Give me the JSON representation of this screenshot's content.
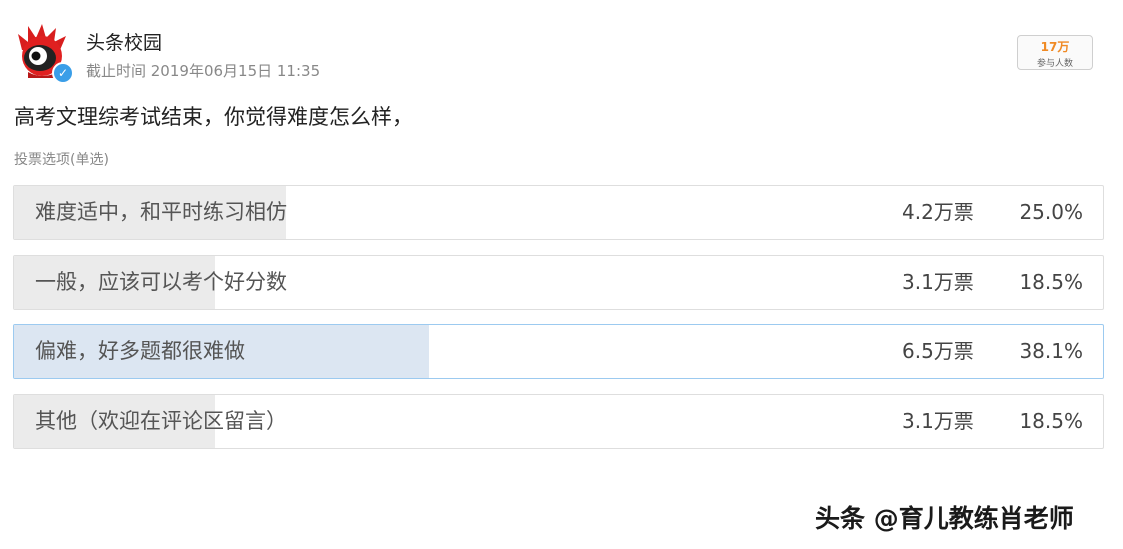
{
  "header": {
    "account_name": "头条校园",
    "deadline": "截止时间 2019年06月15日 11:35",
    "participants_count": "17万",
    "participants_label": "参与人数"
  },
  "question": "高考文理综考试结束，你觉得难度怎么样，",
  "vote_type": "投票选项(单选)",
  "options": [
    {
      "label": "难度适中，和平时练习相仿",
      "votes": "4.2万票",
      "percent": "25.0%",
      "fraction": 0.25,
      "selected": false
    },
    {
      "label": "一般，应该可以考个好分数",
      "votes": "3.1万票",
      "percent": "18.5%",
      "fraction": 0.185,
      "selected": false
    },
    {
      "label": "偏难，好多题都很难做",
      "votes": "6.5万票",
      "percent": "38.1%",
      "fraction": 0.381,
      "selected": true
    },
    {
      "label": "其他（欢迎在评论区留言）",
      "votes": "3.1万票",
      "percent": "18.5%",
      "fraction": 0.185,
      "selected": false
    }
  ],
  "watermark": "头条 @育儿教练肖老师",
  "colors": {
    "selected_fill": "#dce6f2",
    "selected_border": "#9ccaf0",
    "unselected_fill": "#ebebeb",
    "participants_count": "#f08a24",
    "verify_badge": "#3a9ee8"
  },
  "icons": {
    "avatar": "red-crested-bird-avatar",
    "verify": "verified-check-icon"
  }
}
